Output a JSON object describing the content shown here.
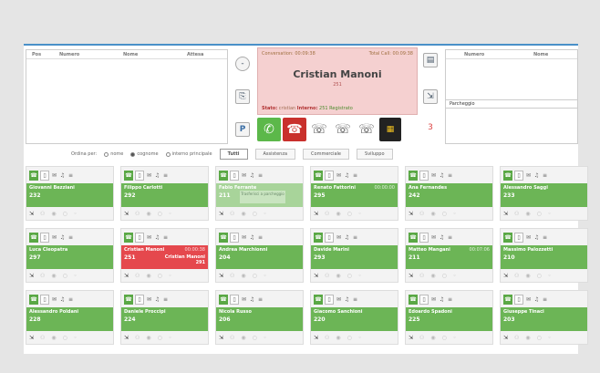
{
  "left_panel": {
    "headers": [
      "Pos",
      "Numero",
      "Nome",
      "Attesa"
    ]
  },
  "call": {
    "conversation": "Conversation: 00:09:38",
    "total_call": "Total Call: 00:09:38",
    "name": "Cristian Manoni",
    "ext": "251",
    "status_label": "Stato:",
    "status_user": "cristian",
    "status_mid": "Interno:",
    "status_value": "251 Registrato"
  },
  "right_panel": {
    "headers": [
      "Numero",
      "Nome"
    ],
    "parking": "Parcheggio"
  },
  "side_buttons": {
    "top_left": "-",
    "mid_left": "⎘",
    "bottom_left": "P",
    "top_right": "▤",
    "mid_right": "⇲",
    "bottom_right": "3"
  },
  "filter": {
    "order_label": "Ordina per:",
    "options": [
      "nome",
      "cognome",
      "interno principale"
    ],
    "tabs": [
      "Tutti",
      "Assistenza",
      "Commerciale",
      "Sviluppo"
    ]
  },
  "cards": [
    {
      "name": "Giovanni Bezziani",
      "num": "232",
      "state": "green"
    },
    {
      "name": "Filippo Carlotti",
      "num": "292",
      "state": "green"
    },
    {
      "name": "Fabio Ferrante",
      "num": "211",
      "state": "pale",
      "transfer": "Trasferisci a parcheggio"
    },
    {
      "name": "Renato Fattorini",
      "num": "295",
      "state": "green",
      "time": "00:00:00"
    },
    {
      "name": "Ana Fernandes",
      "num": "242",
      "state": "green"
    },
    {
      "name": "Alessandro Saggi",
      "num": "233",
      "state": "green"
    },
    {
      "name": "Luca Cleopatra",
      "num": "297",
      "state": "green"
    },
    {
      "name": "Cristian Manoni",
      "num": "251",
      "state": "red",
      "time": "00:00:38",
      "extra": "Cristian Manoni",
      "extra_num": "291"
    },
    {
      "name": "Andrea Marchionni",
      "num": "204",
      "state": "green"
    },
    {
      "name": "Davide Marini",
      "num": "293",
      "state": "green"
    },
    {
      "name": "Matteo Mangani",
      "num": "211",
      "state": "green",
      "time": "00:07:06"
    },
    {
      "name": "Massimo Palozzetti",
      "num": "210",
      "state": "green"
    },
    {
      "name": "Alessandro Poldani",
      "num": "228",
      "state": "green"
    },
    {
      "name": "Daniele Proccipi",
      "num": "224",
      "state": "green"
    },
    {
      "name": "Nicola Russo",
      "num": "206",
      "state": "green"
    },
    {
      "name": "Giacomo Sanchioni",
      "num": "220",
      "state": "green"
    },
    {
      "name": "Edoardo Spadoni",
      "num": "225",
      "state": "green"
    },
    {
      "name": "Giuseppe Tinaci",
      "num": "203",
      "state": "green"
    }
  ]
}
